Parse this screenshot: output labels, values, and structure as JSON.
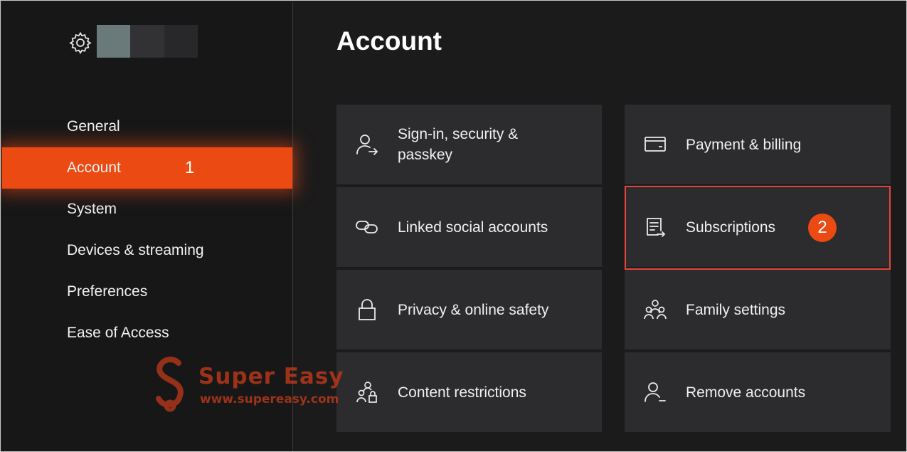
{
  "sidebar": {
    "gear_icon": "gear-icon",
    "gamertag_blur_colors": [
      "#6a7a7a",
      "#323235",
      "#28282a"
    ],
    "items": [
      {
        "label": "General"
      },
      {
        "label": "Account",
        "active": true,
        "step": "1"
      },
      {
        "label": "System"
      },
      {
        "label": "Devices & streaming"
      },
      {
        "label": "Preferences"
      },
      {
        "label": "Ease of Access"
      }
    ]
  },
  "main": {
    "title": "Account",
    "tiles": [
      {
        "label": "Sign-in, security & passkey",
        "icon": "person-arrow-icon"
      },
      {
        "label": "Payment & billing",
        "icon": "card-icon"
      },
      {
        "label": "Linked social accounts",
        "icon": "link-icon"
      },
      {
        "label": "Subscriptions",
        "icon": "document-arrow-icon",
        "step": "2"
      },
      {
        "label": "Privacy & online safety",
        "icon": "lock-icon"
      },
      {
        "label": "Family settings",
        "icon": "family-icon"
      },
      {
        "label": "Content restrictions",
        "icon": "people-lock-icon"
      },
      {
        "label": "Remove accounts",
        "icon": "person-minus-icon"
      }
    ]
  },
  "watermark": {
    "brand": "Super Easy",
    "url": "www.supereasy.com"
  },
  "colors": {
    "accent": "#eb4a12",
    "highlight_border": "#e5453b",
    "tile_bg": "#2c2c2e",
    "background": "#1b1b1c"
  }
}
